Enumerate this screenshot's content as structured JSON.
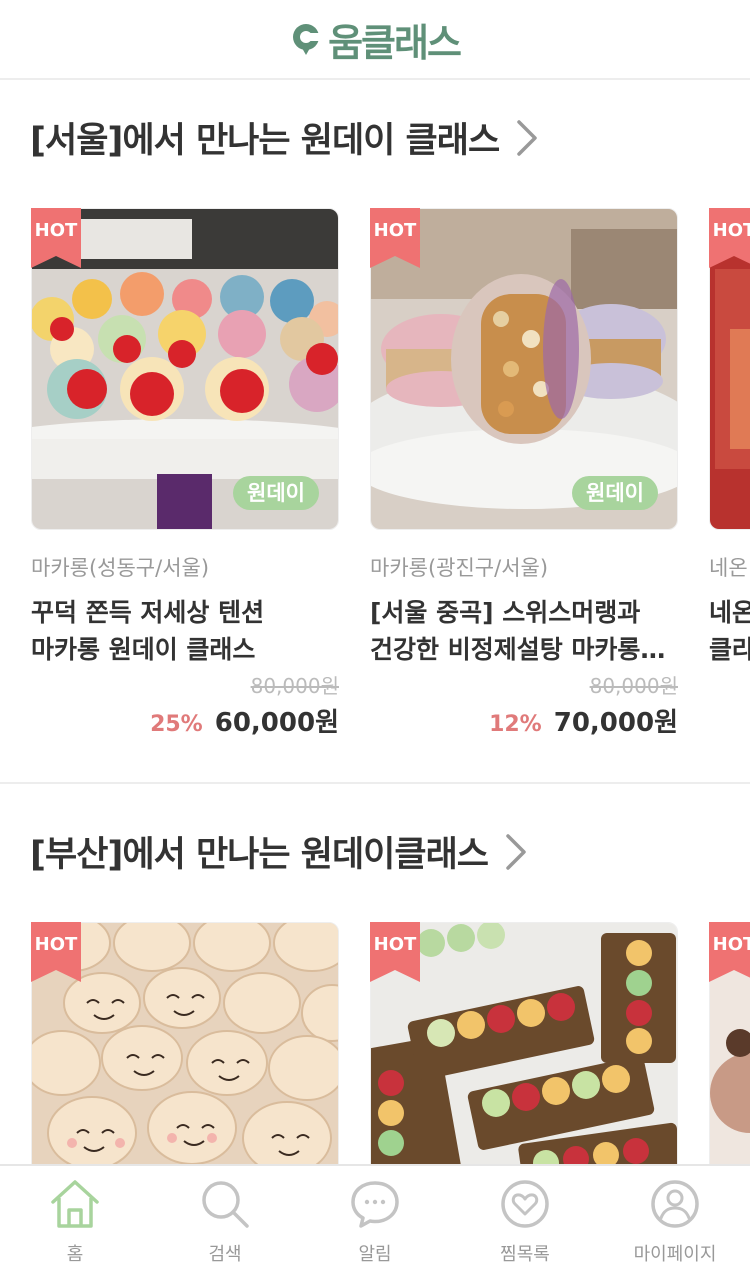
{
  "app": {
    "logo_text": "움클래스",
    "brand_color": "#5f9078"
  },
  "sections": [
    {
      "title": "[서울]에서 만나는 원데이 클래스",
      "cards": [
        {
          "badge": "HOT",
          "tag": "원데이",
          "category": "마카롱(성동구/서울)",
          "name_line1": "꾸덕 쫀득 저세상 텐션",
          "name_line2": "마카롱 원데이 클래스",
          "original_price": "80,000원",
          "discount": "25%",
          "price": "60,000원"
        },
        {
          "badge": "HOT",
          "tag": "원데이",
          "category": "마카롱(광진구/서울)",
          "name_line1": "[서울 중곡] 스위스머랭과",
          "name_line2": "건강한 비정제설탕 마카롱…",
          "original_price": "80,000원",
          "discount": "12%",
          "price": "70,000원"
        },
        {
          "badge": "HOT",
          "category": "네온",
          "name_line1": "네온",
          "name_line2": "클라"
        }
      ]
    },
    {
      "title": "[부산]에서 만나는 원데이클래스",
      "cards": [
        {
          "badge": "HOT"
        },
        {
          "badge": "HOT"
        },
        {
          "badge": "HOT"
        }
      ]
    }
  ],
  "tabbar": [
    {
      "label": "홈",
      "icon": "home-icon",
      "active": true
    },
    {
      "label": "검색",
      "icon": "search-icon",
      "active": false
    },
    {
      "label": "알림",
      "icon": "chat-bubble-icon",
      "active": false
    },
    {
      "label": "찜목록",
      "icon": "heart-icon",
      "active": false
    },
    {
      "label": "마이페이지",
      "icon": "user-icon",
      "active": false
    }
  ],
  "colors": {
    "hot": "#ef7272",
    "oneday_badge": "#a8d49d",
    "discount": "#e07a7a",
    "active_tab": "#a8d49d",
    "inactive_tab": "#c4c4c4"
  }
}
